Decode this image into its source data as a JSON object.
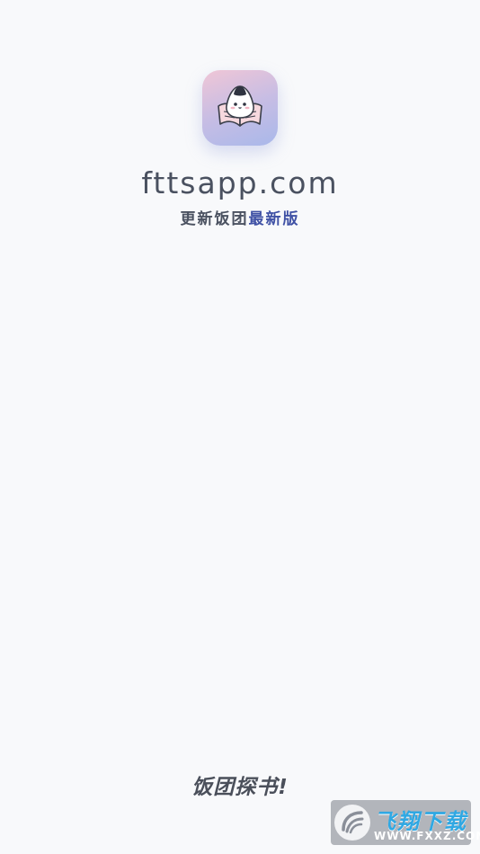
{
  "app": {
    "icon_name": "rice-ball-book-icon",
    "domain": "fttsapp.com",
    "subtitle_plain": "更新饭团",
    "subtitle_accent": "最新版",
    "slogan": "饭团探书!"
  },
  "watermark": {
    "icon_name": "fxxz-logo-icon",
    "title": "飞翔下载",
    "url": "WWW.FXXZ.COM"
  },
  "colors": {
    "background": "#f8f9fb",
    "text": "#4a5160",
    "accent": "#3f51a5",
    "icon_gradient_top": "#f0c6d6",
    "icon_gradient_bottom": "#a9b8ea",
    "watermark_blue": "#2fa8e3"
  }
}
